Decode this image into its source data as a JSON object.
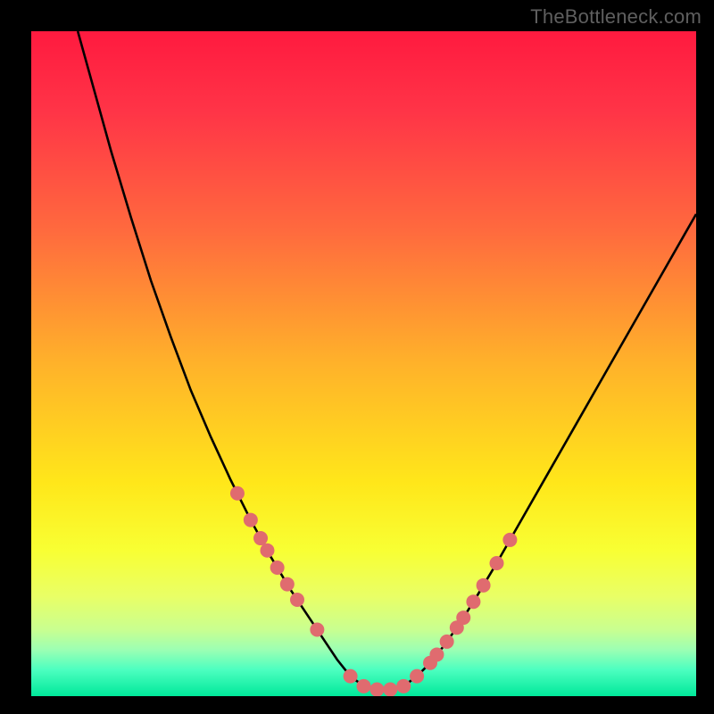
{
  "watermark": "TheBottleneck.com",
  "chart_data": {
    "type": "line",
    "title": "",
    "xlabel": "",
    "ylabel": "",
    "xlim": [
      0,
      100
    ],
    "ylim": [
      0,
      100
    ],
    "grid": false,
    "legend": false,
    "background": {
      "type": "vertical-gradient",
      "stops": [
        {
          "pos": 0.0,
          "color": "#ff1a3f"
        },
        {
          "pos": 0.12,
          "color": "#ff3447"
        },
        {
          "pos": 0.3,
          "color": "#ff6a3e"
        },
        {
          "pos": 0.5,
          "color": "#ffb22a"
        },
        {
          "pos": 0.68,
          "color": "#ffe71a"
        },
        {
          "pos": 0.78,
          "color": "#f8ff33"
        },
        {
          "pos": 0.85,
          "color": "#e9ff66"
        },
        {
          "pos": 0.9,
          "color": "#c9ff90"
        },
        {
          "pos": 0.93,
          "color": "#9cffb3"
        },
        {
          "pos": 0.96,
          "color": "#4dffc0"
        },
        {
          "pos": 1.0,
          "color": "#00e89a"
        }
      ]
    },
    "series": [
      {
        "name": "bottleneck-curve",
        "color": "#000000",
        "points": [
          {
            "x": 7.0,
            "y": 100.0
          },
          {
            "x": 9.5,
            "y": 91.0
          },
          {
            "x": 12.0,
            "y": 82.0
          },
          {
            "x": 15.0,
            "y": 72.0
          },
          {
            "x": 18.0,
            "y": 62.5
          },
          {
            "x": 21.0,
            "y": 54.0
          },
          {
            "x": 24.0,
            "y": 46.0
          },
          {
            "x": 27.0,
            "y": 39.0
          },
          {
            "x": 30.0,
            "y": 32.5
          },
          {
            "x": 33.0,
            "y": 26.5
          },
          {
            "x": 36.0,
            "y": 21.0
          },
          {
            "x": 39.0,
            "y": 16.0
          },
          {
            "x": 42.0,
            "y": 11.5
          },
          {
            "x": 44.0,
            "y": 8.5
          },
          {
            "x": 46.0,
            "y": 5.5
          },
          {
            "x": 48.0,
            "y": 3.0
          },
          {
            "x": 50.0,
            "y": 1.5
          },
          {
            "x": 52.0,
            "y": 1.0
          },
          {
            "x": 54.0,
            "y": 1.0
          },
          {
            "x": 56.0,
            "y": 1.5
          },
          {
            "x": 58.0,
            "y": 3.0
          },
          {
            "x": 60.0,
            "y": 5.0
          },
          {
            "x": 62.0,
            "y": 7.5
          },
          {
            "x": 64.5,
            "y": 11.0
          },
          {
            "x": 67.0,
            "y": 15.0
          },
          {
            "x": 70.0,
            "y": 20.0
          },
          {
            "x": 74.0,
            "y": 27.0
          },
          {
            "x": 78.0,
            "y": 34.0
          },
          {
            "x": 82.0,
            "y": 41.0
          },
          {
            "x": 86.0,
            "y": 48.0
          },
          {
            "x": 90.0,
            "y": 55.0
          },
          {
            "x": 94.0,
            "y": 62.0
          },
          {
            "x": 98.0,
            "y": 69.0
          },
          {
            "x": 100.0,
            "y": 72.5
          }
        ]
      }
    ],
    "scatter": {
      "name": "markers",
      "color": "#e06b6f",
      "radius": 8,
      "points_on_curve_x": [
        31.0,
        33.0,
        34.5,
        35.5,
        37.0,
        38.5,
        40.0,
        43.0,
        48.0,
        50.0,
        52.0,
        54.0,
        56.0,
        58.0,
        60.0,
        61.0,
        62.5,
        64.0,
        65.0,
        66.5,
        68.0,
        70.0,
        72.0
      ]
    }
  }
}
